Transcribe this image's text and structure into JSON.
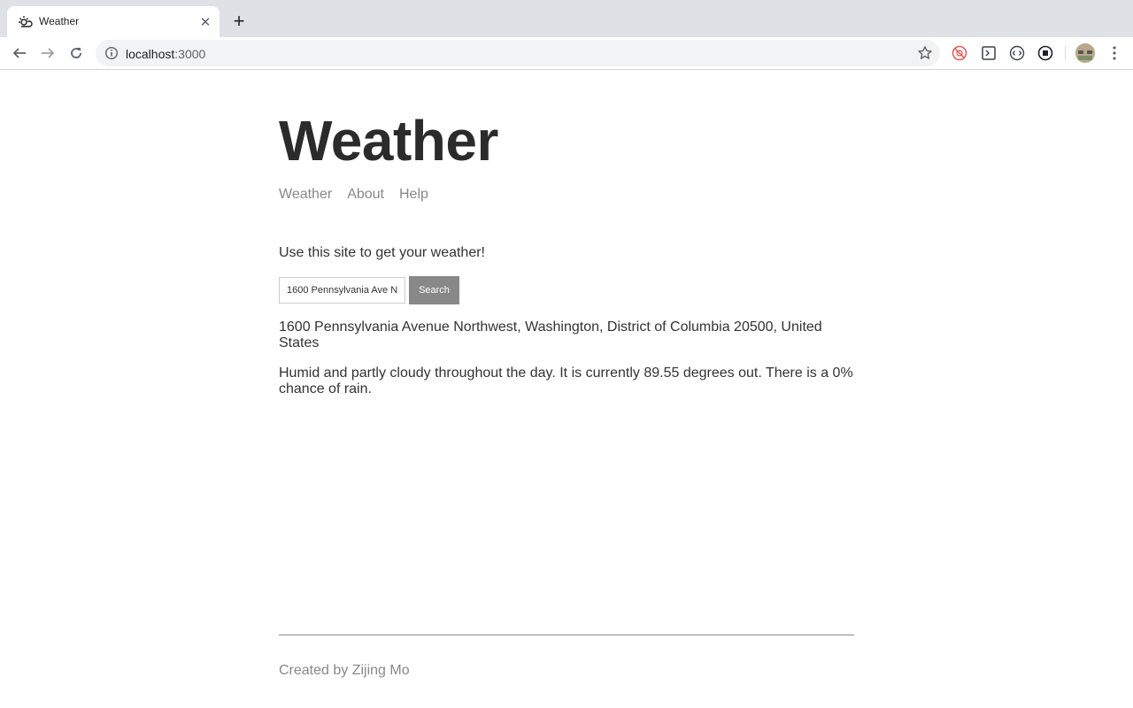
{
  "browser": {
    "tab_title": "Weather",
    "url_host": "localhost",
    "url_port": ":3000",
    "tab_close_glyph": "✕",
    "new_tab_glyph": "+"
  },
  "site": {
    "title": "Weather",
    "nav": [
      "Weather",
      "About",
      "Help"
    ],
    "intro": "Use this site to get your weather!",
    "search": {
      "value": "1600 Pennsylvania Ave N",
      "button_label": "Search"
    },
    "location": "1600 Pennsylvania Avenue Northwest, Washington, District of Columbia 20500, United States",
    "forecast": "Humid and partly cloudy throughout the day. It is currently 89.55 degrees out. There is a 0% chance of rain.",
    "footer": "Created by Zijing Mo"
  },
  "colors": {
    "title": "#2b2b2b",
    "nav_link": "#888888",
    "button_bg": "#888888",
    "tabstrip": "#dee1e6"
  }
}
